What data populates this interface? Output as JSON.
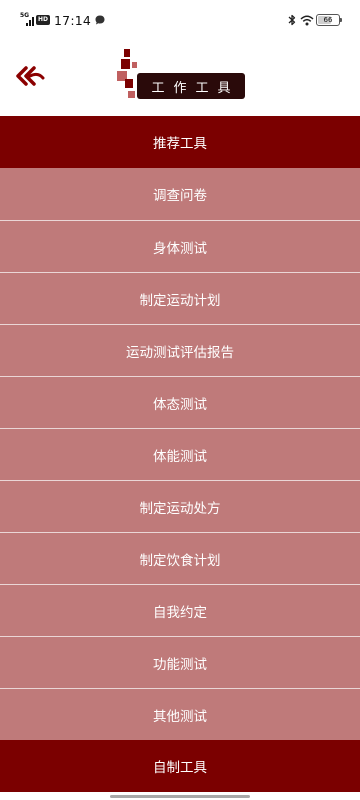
{
  "status_bar": {
    "network": "5G",
    "hd_badge": "HD",
    "time": "17:14",
    "battery": "66",
    "battery_level": 0.66
  },
  "header": {
    "title": "工作工具",
    "back_icon": "double-chevron-left-icon"
  },
  "colors": {
    "section_bg": "#7b0000",
    "item_bg": "#bf7a7a",
    "title_box": "#2a0a0a"
  },
  "menu": {
    "recommended_header": "推荐工具",
    "items": [
      "调查问卷",
      "身体测试",
      "制定运动计划",
      "运动测试评估报告",
      "体态测试",
      "体能测试",
      "制定运动处方",
      "制定饮食计划",
      "自我约定",
      "功能测试",
      "其他测试"
    ],
    "custom_header": "自制工具"
  }
}
